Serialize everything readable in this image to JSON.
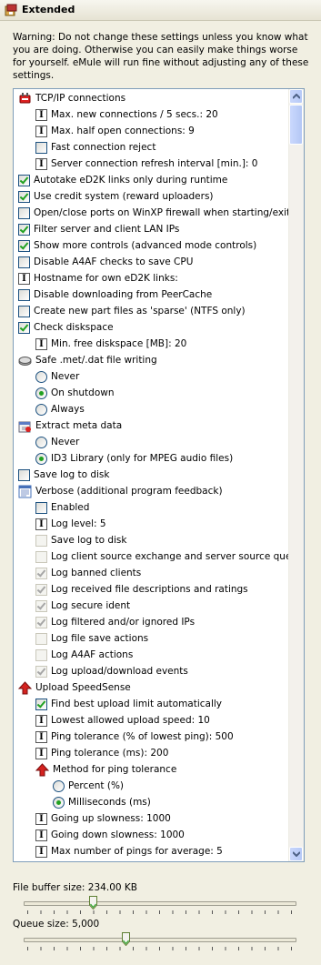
{
  "title": "Extended",
  "warning": "Warning: Do not change these settings unless you know what you are doing. Otherwise you can easily make things worse for yourself. eMule will run fine without adjusting any of these settings.",
  "items": [
    {
      "label": "TCP/IP connections",
      "kind": "icon",
      "icon": "tcpip-icon",
      "indent": 0
    },
    {
      "label": "Max. new connections / 5 secs.: 20",
      "kind": "edit",
      "indent": 1
    },
    {
      "label": "Max. half open connections: 9",
      "kind": "edit",
      "indent": 1
    },
    {
      "label": "Fast connection reject",
      "kind": "check",
      "checked": false,
      "indent": 1
    },
    {
      "label": "Server connection refresh interval [min.]: 0",
      "kind": "edit",
      "indent": 1
    },
    {
      "label": "Autotake eD2K links only during runtime",
      "kind": "check",
      "checked": true,
      "indent": 0
    },
    {
      "label": "Use credit system (reward uploaders)",
      "kind": "check",
      "checked": true,
      "indent": 0
    },
    {
      "label": "Open/close ports on WinXP firewall when starting/exiting",
      "kind": "check",
      "checked": false,
      "indent": 0
    },
    {
      "label": "Filter server and client LAN IPs",
      "kind": "check",
      "checked": true,
      "indent": 0
    },
    {
      "label": "Show more controls (advanced mode controls)",
      "kind": "check",
      "checked": true,
      "indent": 0
    },
    {
      "label": "Disable A4AF checks to save CPU",
      "kind": "check",
      "checked": false,
      "indent": 0
    },
    {
      "label": "Hostname for own eD2K links:",
      "kind": "edit",
      "indent": 0
    },
    {
      "label": "Disable downloading from PeerCache",
      "kind": "check",
      "checked": false,
      "indent": 0
    },
    {
      "label": "Create new part files as 'sparse' (NTFS only)",
      "kind": "check",
      "checked": false,
      "indent": 0
    },
    {
      "label": "Check diskspace",
      "kind": "check",
      "checked": true,
      "indent": 0
    },
    {
      "label": "Min. free diskspace [MB]: 20",
      "kind": "edit",
      "indent": 1
    },
    {
      "label": "Safe .met/.dat file writing",
      "kind": "icon",
      "icon": "disk-icon",
      "indent": 0
    },
    {
      "label": "Never",
      "kind": "radio",
      "checked": false,
      "indent": 1
    },
    {
      "label": "On shutdown",
      "kind": "radio",
      "checked": true,
      "indent": 1
    },
    {
      "label": "Always",
      "kind": "radio",
      "checked": false,
      "indent": 1
    },
    {
      "label": "Extract meta data",
      "kind": "icon",
      "icon": "metadata-icon",
      "indent": 0
    },
    {
      "label": "Never",
      "kind": "radio",
      "checked": false,
      "indent": 1
    },
    {
      "label": "ID3 Library (only for MPEG audio files)",
      "kind": "radio",
      "checked": true,
      "indent": 1
    },
    {
      "label": "Save log to disk",
      "kind": "check",
      "checked": false,
      "indent": 0
    },
    {
      "label": "Verbose (additional program feedback)",
      "kind": "icon",
      "icon": "verbose-icon",
      "indent": 0
    },
    {
      "label": "Enabled",
      "kind": "check",
      "checked": false,
      "indent": 1
    },
    {
      "label": "Log level: 5",
      "kind": "edit",
      "indent": 1
    },
    {
      "label": "Save log to disk",
      "kind": "check",
      "checked": false,
      "disabled": true,
      "indent": 1
    },
    {
      "label": "Log client source exchange and server source queries",
      "kind": "check",
      "checked": false,
      "disabled": true,
      "indent": 1
    },
    {
      "label": "Log banned clients",
      "kind": "check",
      "checked": true,
      "disabled": true,
      "indent": 1
    },
    {
      "label": "Log received file descriptions and ratings",
      "kind": "check",
      "checked": true,
      "disabled": true,
      "indent": 1
    },
    {
      "label": "Log secure ident",
      "kind": "check",
      "checked": true,
      "disabled": true,
      "indent": 1
    },
    {
      "label": "Log filtered and/or ignored IPs",
      "kind": "check",
      "checked": true,
      "disabled": true,
      "indent": 1
    },
    {
      "label": "Log file save actions",
      "kind": "check",
      "checked": false,
      "disabled": true,
      "indent": 1
    },
    {
      "label": "Log A4AF actions",
      "kind": "check",
      "checked": false,
      "disabled": true,
      "indent": 1
    },
    {
      "label": "Log upload/download events",
      "kind": "check",
      "checked": true,
      "disabled": true,
      "indent": 1
    },
    {
      "label": "Upload SpeedSense",
      "kind": "icon",
      "icon": "upload-arrow-icon",
      "indent": 0
    },
    {
      "label": "Find best upload limit automatically",
      "kind": "check",
      "checked": true,
      "indent": 1
    },
    {
      "label": "Lowest allowed upload speed: 10",
      "kind": "edit",
      "indent": 1
    },
    {
      "label": "Ping tolerance (% of lowest ping): 500",
      "kind": "edit",
      "indent": 1
    },
    {
      "label": "Ping tolerance (ms): 200",
      "kind": "edit",
      "indent": 1
    },
    {
      "label": "Method for ping tolerance",
      "kind": "icon",
      "icon": "upload-arrow-icon",
      "indent": 1
    },
    {
      "label": "Percent (%)",
      "kind": "radio",
      "checked": false,
      "indent": 2
    },
    {
      "label": "Milliseconds (ms)",
      "kind": "radio",
      "checked": true,
      "indent": 2
    },
    {
      "label": "Going up slowness: 1000",
      "kind": "edit",
      "indent": 1
    },
    {
      "label": "Going down slowness: 1000",
      "kind": "edit",
      "indent": 1
    },
    {
      "label": "Max number of pings for average: 5",
      "kind": "edit",
      "indent": 1
    }
  ],
  "file_buffer": {
    "label": "File buffer size: 234.00 KB",
    "fraction": 0.26
  },
  "queue_size": {
    "label": "Queue size: 5,000",
    "fraction": 0.38
  }
}
